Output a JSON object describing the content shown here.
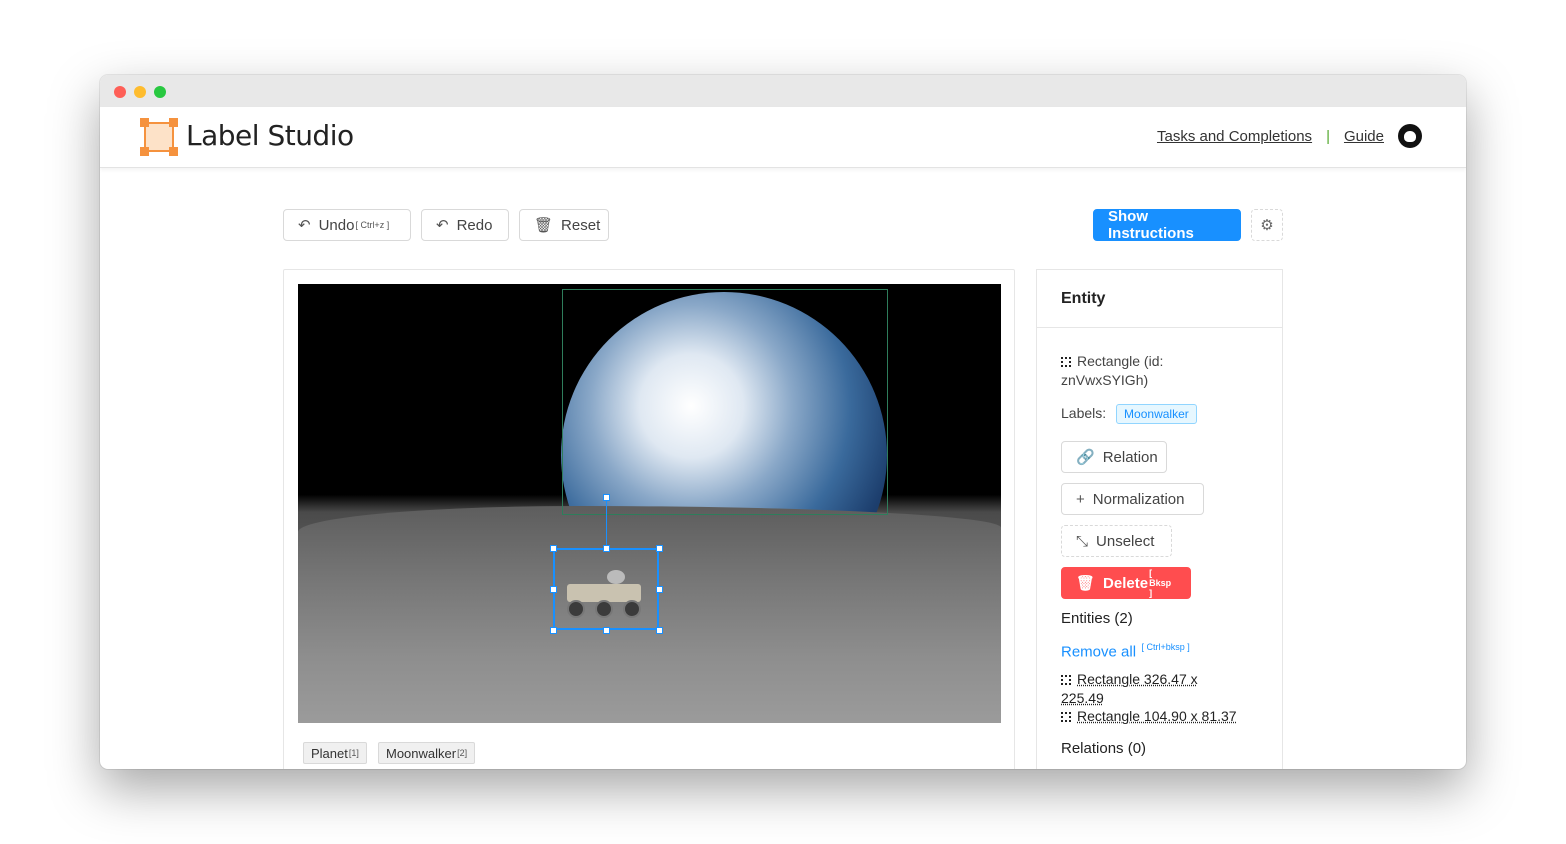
{
  "app": {
    "brand": "Label Studio"
  },
  "header": {
    "links": [
      {
        "label": "Tasks and Completions"
      },
      {
        "label": "Guide"
      }
    ],
    "separator": "|"
  },
  "toolbar": {
    "undo_label": "Undo",
    "undo_shortcut": "[ Ctrl+z ]",
    "redo_label": "Redo",
    "reset_label": "Reset",
    "instructions_label": "Show Instructions"
  },
  "labels_bar": {
    "tags": [
      {
        "label": "Planet",
        "shortcut": "[1]"
      },
      {
        "label": "Moonwalker",
        "shortcut": "[2]"
      }
    ]
  },
  "entity_panel": {
    "title": "Entity",
    "region_line1": "Rectangle (id:",
    "region_line2": "znVwxSYIGh)",
    "labels_prefix": "Labels:",
    "selected_label": "Moonwalker",
    "relation_label": "Relation",
    "normalization_label": "Normalization",
    "unselect_label": "Unselect",
    "delete_label": "Delete",
    "delete_shortcut": "[ Bksp ]",
    "entities_heading": "Entities (2)",
    "remove_all_label": "Remove all",
    "remove_all_shortcut": "[ Ctrl+bksp ]",
    "entities": [
      {
        "line1": "Rectangle  326.47 x",
        "line2": "225.49"
      },
      {
        "line1": "Rectangle  104.90 x 81.37"
      }
    ],
    "relations_heading": "Relations (0)"
  },
  "colors": {
    "accent": "#1890ff",
    "danger": "#ff4d4f",
    "brand": "#f5923e"
  }
}
